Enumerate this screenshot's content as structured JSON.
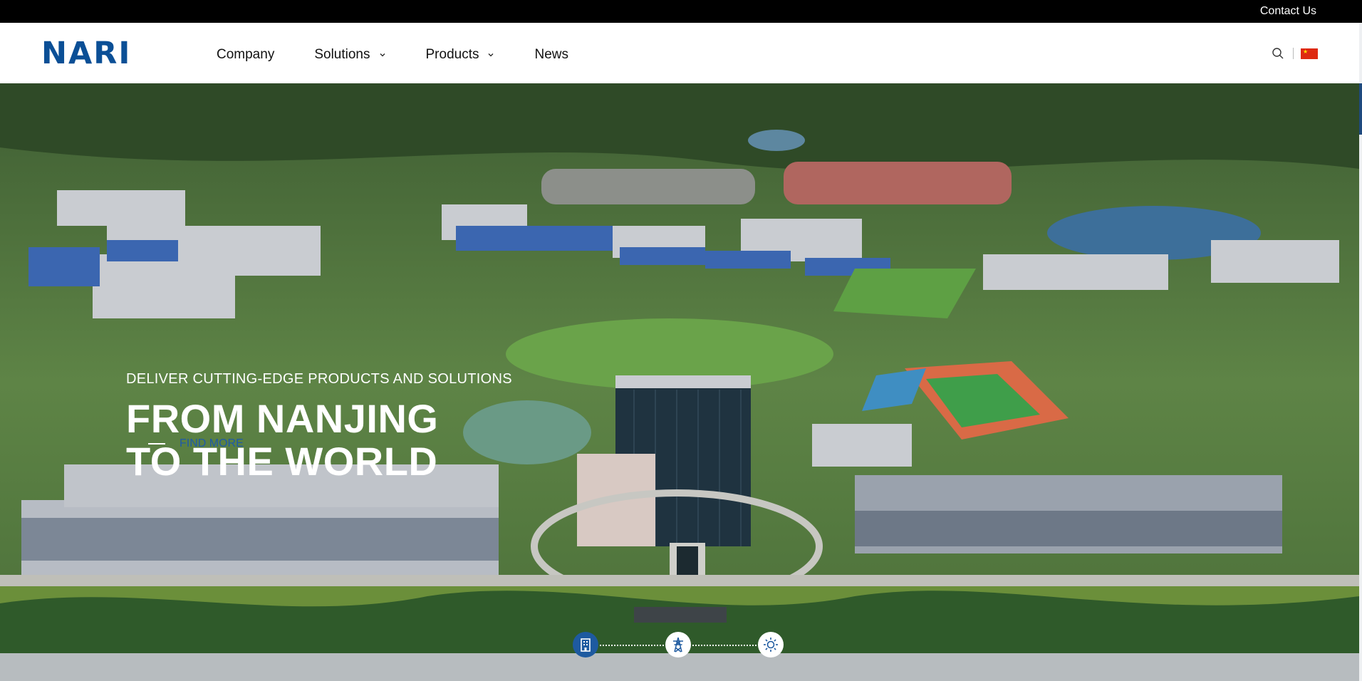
{
  "topbar": {
    "contact_label": "Contact Us"
  },
  "header": {
    "logo_text": "NARI",
    "nav": [
      {
        "label": "Company",
        "has_dropdown": false
      },
      {
        "label": "Solutions",
        "has_dropdown": true
      },
      {
        "label": "Products",
        "has_dropdown": true
      },
      {
        "label": "News",
        "has_dropdown": false
      }
    ],
    "icons": [
      "search-icon",
      "china-flag-icon"
    ]
  },
  "hero": {
    "tagline": "DELIVER CUTTING-EDGE PRODUCTS AND SOLUTIONS",
    "headline_line1": "FROM NANJING",
    "headline_line2": "TO THE WORLD",
    "cta_label": "FIND MORE",
    "slide_icons": [
      "building-icon",
      "power-tower-icon",
      "sun-icon"
    ],
    "active_slide": 1
  },
  "colors": {
    "brand": "#0b4f96",
    "topbar": "#000000",
    "accent": "#1e5aa0"
  }
}
